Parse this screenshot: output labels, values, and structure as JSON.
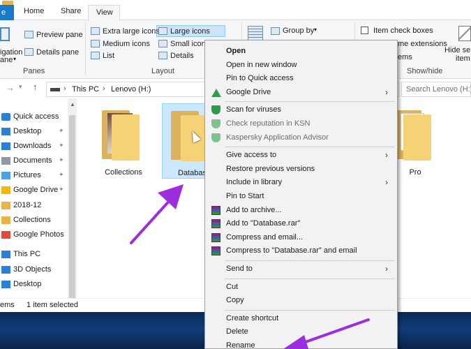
{
  "tabs": {
    "home": "Home",
    "share": "Share",
    "view": "View"
  },
  "ribbon": {
    "panes": {
      "navigation_line1": "igation",
      "navigation_line2": "ane",
      "preview": "Preview pane",
      "details": "Details pane",
      "group": "Panes"
    },
    "layout": {
      "extra_large": "Extra large icons",
      "large": "Large icons",
      "medium": "Medium icons",
      "small": "Small icons",
      "list": "List",
      "details": "Details",
      "group": "Layout"
    },
    "current_view": {
      "group_by": "Group by"
    },
    "show_hide": {
      "item_check_boxes": "Item check boxes",
      "extensions": "me extensions",
      "hidden": "ems",
      "hide_selected_1": "Hide se",
      "hide_selected_2": "item",
      "group": "Show/hide"
    }
  },
  "address": {
    "path": [
      "This PC",
      "Lenovo (H:)"
    ],
    "search_placeholder": "Search Lenovo (H:)"
  },
  "nav": {
    "items": [
      {
        "label": "Quick access",
        "icon": "star-icon",
        "pinned": false
      },
      {
        "label": "Desktop",
        "icon": "desktop-icon",
        "pinned": true
      },
      {
        "label": "Downloads",
        "icon": "download-icon",
        "pinned": true
      },
      {
        "label": "Documents",
        "icon": "documents-icon",
        "pinned": true
      },
      {
        "label": "Pictures",
        "icon": "pictures-icon",
        "pinned": true
      },
      {
        "label": "Google Drive",
        "icon": "google-drive-icon",
        "pinned": true
      },
      {
        "label": "2018-12",
        "icon": "folder-icon",
        "pinned": false
      },
      {
        "label": "Collections",
        "icon": "folder-icon",
        "pinned": false
      },
      {
        "label": "Google Photos",
        "icon": "google-photos-icon",
        "pinned": false
      },
      {
        "label": "This PC",
        "icon": "pc-icon",
        "pinned": false
      },
      {
        "label": "3D Objects",
        "icon": "3d-objects-icon",
        "pinned": false
      },
      {
        "label": "Desktop",
        "icon": "desktop-icon",
        "pinned": false
      }
    ]
  },
  "content": {
    "files": [
      {
        "name": "Collections",
        "type": "folder"
      },
      {
        "name": "Databas",
        "type": "folder",
        "selected": true
      },
      {
        "name": "Pro",
        "type": "folder"
      }
    ]
  },
  "status": {
    "count": "ems",
    "selection": "1 item selected"
  },
  "context_menu": {
    "items": [
      {
        "label": "Open",
        "bold": true
      },
      {
        "label": "Open in new window"
      },
      {
        "label": "Pin to Quick access"
      },
      {
        "label": "Google Drive",
        "icon": "google-drive-icon",
        "submenu": true
      },
      {
        "separator": true
      },
      {
        "label": "Scan for viruses",
        "icon": "kaspersky-shield-icon"
      },
      {
        "label": "Check reputation in KSN",
        "icon": "kaspersky-shield-icon",
        "disabled": true
      },
      {
        "label": "Kaspersky Application Advisor",
        "icon": "kaspersky-shield-icon",
        "disabled": true
      },
      {
        "separator": true
      },
      {
        "label": "Give access to",
        "submenu": true
      },
      {
        "label": "Restore previous versions"
      },
      {
        "label": "Include in library",
        "submenu": true
      },
      {
        "label": "Pin to Start"
      },
      {
        "label": "Add to archive...",
        "icon": "winrar-icon"
      },
      {
        "label": "Add to \"Database.rar\"",
        "icon": "winrar-icon"
      },
      {
        "label": "Compress and email...",
        "icon": "winrar-icon"
      },
      {
        "label": "Compress to \"Database.rar\" and email",
        "icon": "winrar-icon"
      },
      {
        "separator": true
      },
      {
        "label": "Send to",
        "submenu": true
      },
      {
        "separator": true
      },
      {
        "label": "Cut"
      },
      {
        "label": "Copy"
      },
      {
        "separator": true
      },
      {
        "label": "Create shortcut"
      },
      {
        "label": "Delete"
      },
      {
        "label": "Rename"
      }
    ]
  },
  "colors": {
    "annotation_arrow": "#9b2fe0",
    "selection": "#cce8ff",
    "file_tab": "#1979ca"
  }
}
